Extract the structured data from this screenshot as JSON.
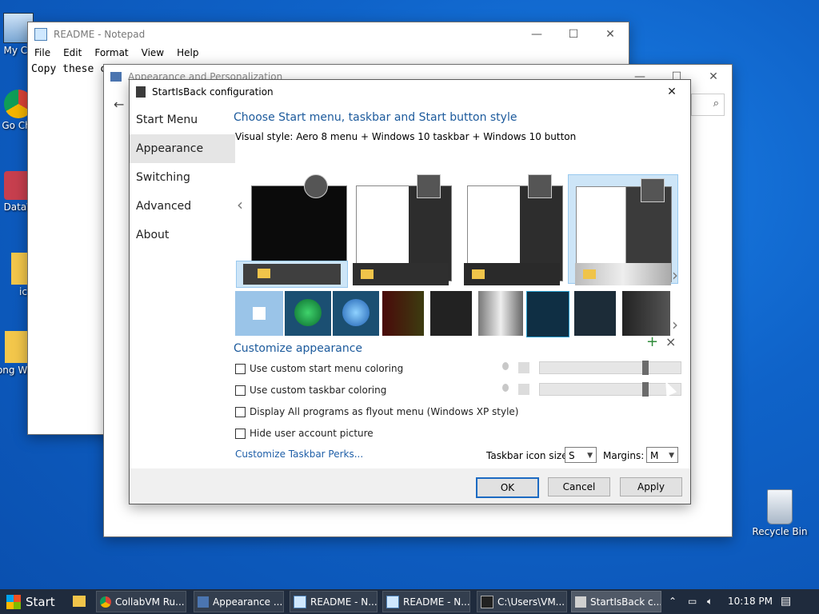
{
  "desktop": {
    "icons": [
      {
        "label": "My Co"
      },
      {
        "label": "Go Chr"
      },
      {
        "label": "DataV"
      },
      {
        "label": "ic"
      },
      {
        "label": "Long Wind"
      },
      {
        "label": "Recycle Bin"
      }
    ]
  },
  "notepad": {
    "title": "README - Notepad",
    "menu": [
      "File",
      "Edit",
      "Format",
      "View",
      "Help"
    ],
    "text": "Copy these c",
    "bullet": "•"
  },
  "appearance_window": {
    "title": "Appearance and Personalization"
  },
  "dialog": {
    "title": "StartIsBack configuration",
    "nav": [
      "Start Menu",
      "Appearance",
      "Switching",
      "Advanced",
      "About"
    ],
    "heading": "Choose Start menu, taskbar and Start button style",
    "visual_style": "Visual style:  Aero 8 menu + Windows 10 taskbar + Windows 10 button",
    "customize_heading": "Customize appearance",
    "options": [
      "Use custom start menu coloring",
      "Use custom taskbar coloring",
      "Display All programs as flyout menu (Windows XP style)",
      "Hide user account picture"
    ],
    "perks_link": "Customize Taskbar Perks...",
    "icon_size_label": "Taskbar icon size:",
    "icon_size_value": "S",
    "margins_label": "Margins:",
    "margins_value": "M",
    "ok": "OK",
    "cancel": "Cancel",
    "apply": "Apply",
    "add_glyph": "+",
    "remove_glyph": "×",
    "prev_glyph": "‹",
    "next_glyph": "›"
  },
  "taskbar": {
    "start": "Start",
    "items": [
      "CollabVM Ru...",
      "Appearance ...",
      "README - N...",
      "README - N...",
      "C:\\Users\\VM...",
      "StartIsBack c..."
    ],
    "time": "10:18 PM"
  },
  "colors": {
    "accent": "#1c5a9c",
    "link": "#1f5fa8",
    "selected_thumb": "#cde5f7"
  }
}
